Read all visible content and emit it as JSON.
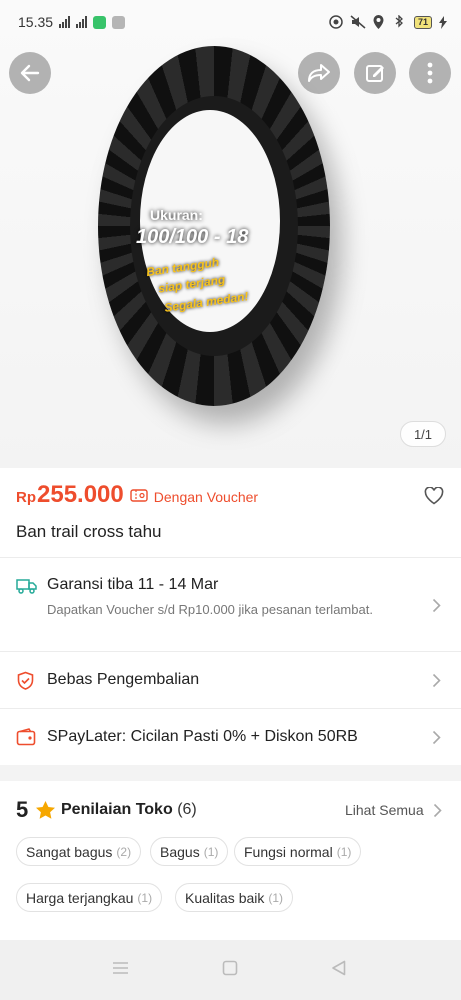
{
  "status_bar": {
    "time": "15.35",
    "battery": "71",
    "colors": {
      "app_icon_1": "#38c36a",
      "app_icon_2": "#b5b5b5"
    }
  },
  "hero": {
    "size_label": "Ukuran:",
    "size_value": "100/100 - 18",
    "tagline": [
      "Ban tangguh",
      "siap terjang",
      "Segala medan!"
    ],
    "image_counter": "1/1"
  },
  "top_actions": {
    "back_icon": "arrow-left-icon",
    "share_icon": "share-arrow-icon",
    "edit_icon": "edit-pencil-icon",
    "more_icon": "more-vertical-icon"
  },
  "product": {
    "currency": "Rp",
    "price": "255.000",
    "voucher_text": "Dengan Voucher",
    "title": "Ban trail cross tahu",
    "accent_color": "#ee4d2d"
  },
  "info_rows": [
    {
      "icon": "truck-icon",
      "title": "Garansi tiba 11 - 14 Mar",
      "subtitle": "Dapatkan Voucher s/d Rp10.000 jika pesanan terlambat."
    },
    {
      "icon": "shield-check-icon",
      "title": "Bebas Pengembalian"
    },
    {
      "icon": "wallet-card-icon",
      "title": "SPayLater: Cicilan Pasti 0% + Diskon 50RB"
    }
  ],
  "shop_rating": {
    "score": "5",
    "label": "Penilaian Toko",
    "count": "(6)",
    "see_all": "Lihat Semua",
    "star_color": "#f6a700",
    "chips": [
      {
        "label": "Sangat bagus",
        "count": "(2)"
      },
      {
        "label": "Bagus",
        "count": "(1)"
      },
      {
        "label": "Fungsi normal",
        "count": "(1)"
      },
      {
        "label": "Harga terjangkau",
        "count": "(1)"
      },
      {
        "label": "Kualitas baik",
        "count": "(1)"
      }
    ]
  },
  "nav_bar": {
    "buttons": [
      "menu-lines-icon",
      "home-square-icon",
      "back-triangle-icon"
    ]
  }
}
